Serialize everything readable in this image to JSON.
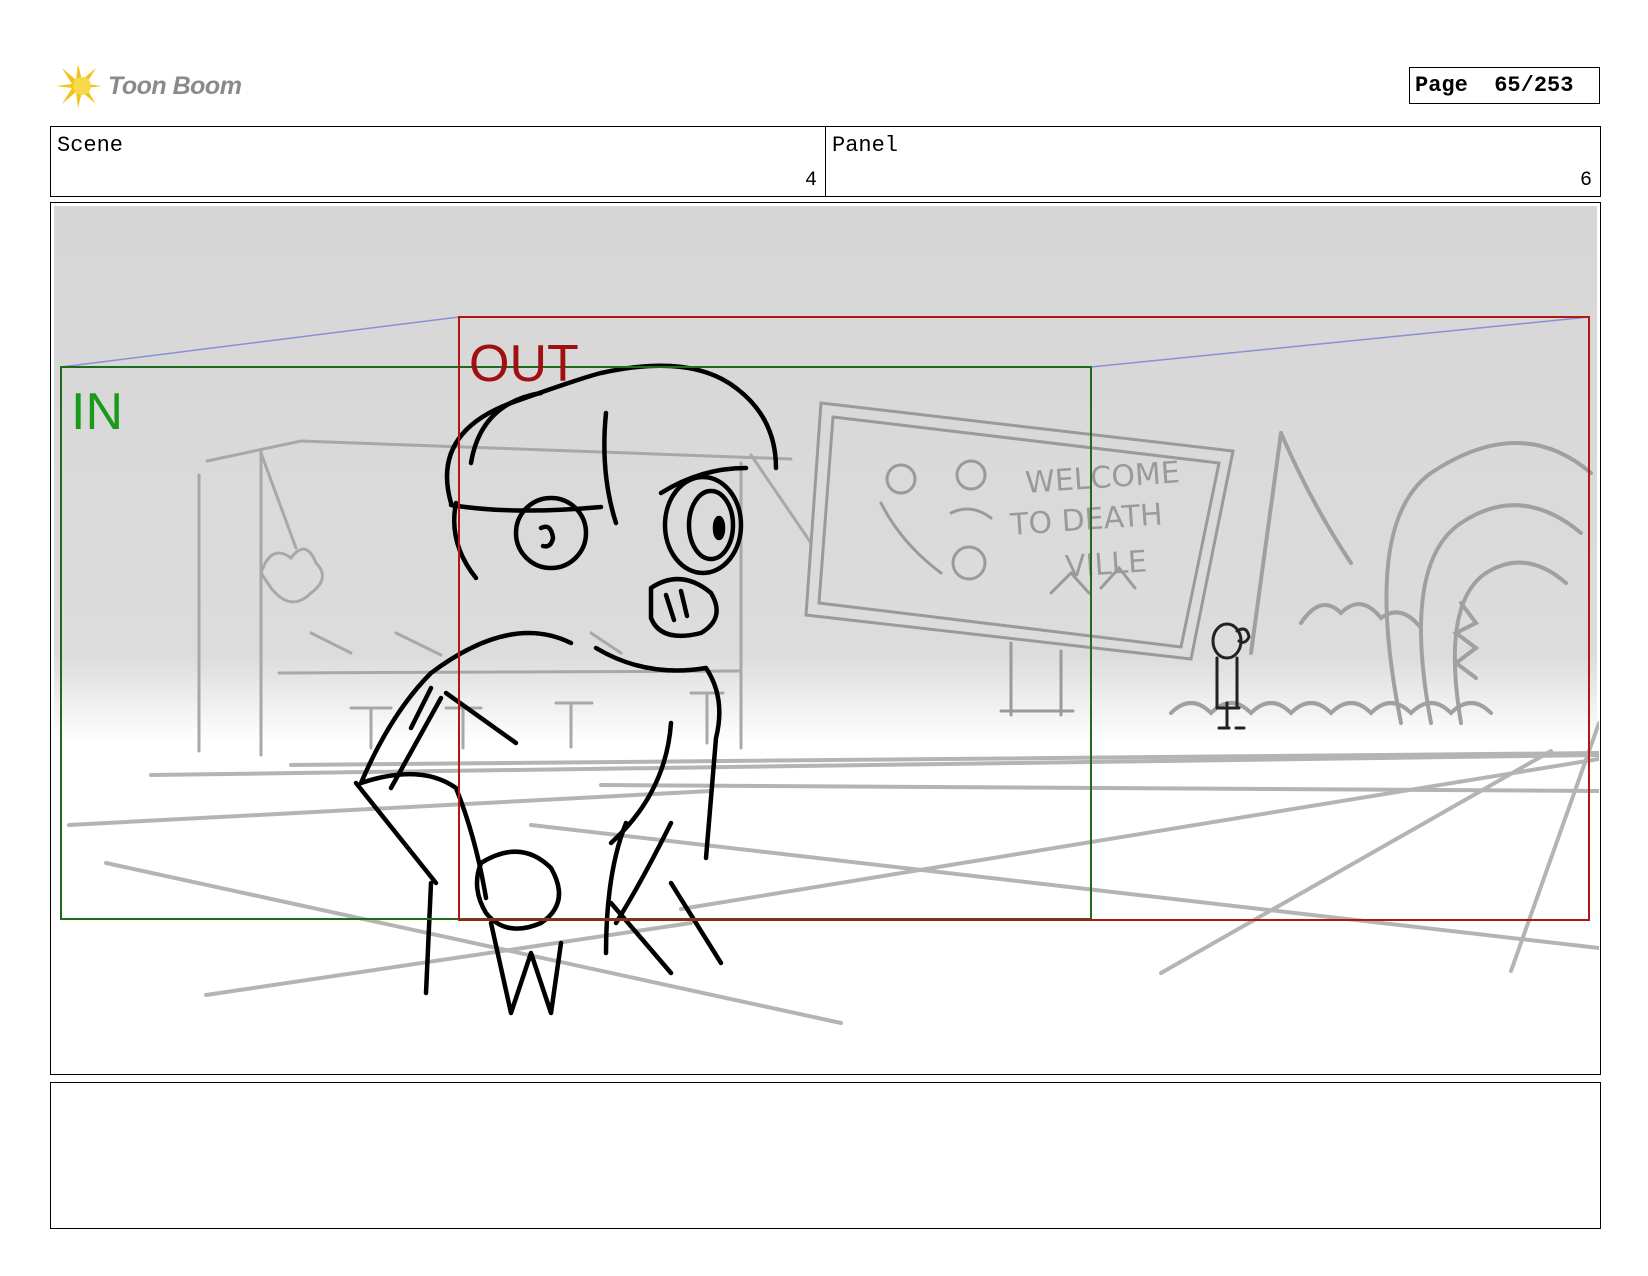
{
  "brand": {
    "name": "Toon Boom",
    "accent": "#f2c316"
  },
  "page": {
    "label": "Page",
    "number": "65/253"
  },
  "header": {
    "scene": {
      "label": "Scene",
      "value": "4"
    },
    "panel": {
      "label": "Panel",
      "value": "6"
    }
  },
  "frames": {
    "in": {
      "label": "IN",
      "color": "#1a9a1a"
    },
    "out": {
      "label": "OUT",
      "color": "#a01010"
    }
  },
  "billboard": {
    "text": [
      "WELCOME",
      "TO DEATH",
      "VILLE"
    ]
  },
  "notes": {
    "text": ""
  }
}
